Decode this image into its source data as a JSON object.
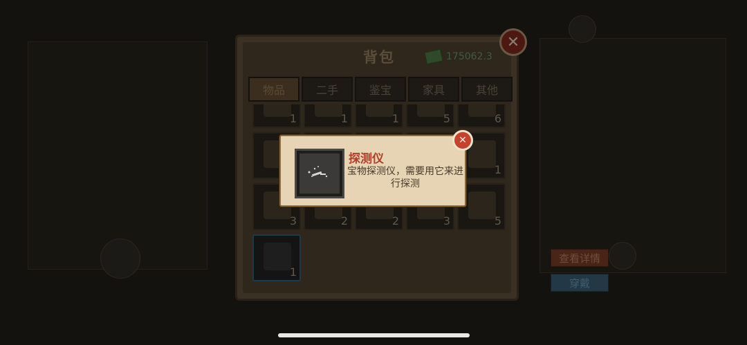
{
  "bag": {
    "title": "背包",
    "money": "175062.3",
    "tabs": [
      {
        "label": "物品",
        "active": true
      },
      {
        "label": "二手",
        "active": false
      },
      {
        "label": "鉴宝",
        "active": false
      },
      {
        "label": "家具",
        "active": false
      },
      {
        "label": "其他",
        "active": false
      }
    ],
    "items": [
      {
        "count": "1"
      },
      {
        "count": "1"
      },
      {
        "count": "1"
      },
      {
        "count": "5"
      },
      {
        "count": "6"
      },
      {
        "count": ""
      },
      {
        "count": ""
      },
      {
        "count": ""
      },
      {
        "count": ""
      },
      {
        "count": "1"
      },
      {
        "count": "3"
      },
      {
        "count": "2"
      },
      {
        "count": "2"
      },
      {
        "count": "3"
      },
      {
        "count": "5"
      },
      {
        "count": "1"
      }
    ]
  },
  "tooltip": {
    "name": "探测仪",
    "description": "宝物探测仪，需要用它来进行探测",
    "close_icon": "close-x"
  },
  "actions": {
    "detail_label": "查看详情",
    "wear_label": "穿戴"
  },
  "colors": {
    "tooltip_title": "#b0402a",
    "close_button": "#c5432c"
  }
}
